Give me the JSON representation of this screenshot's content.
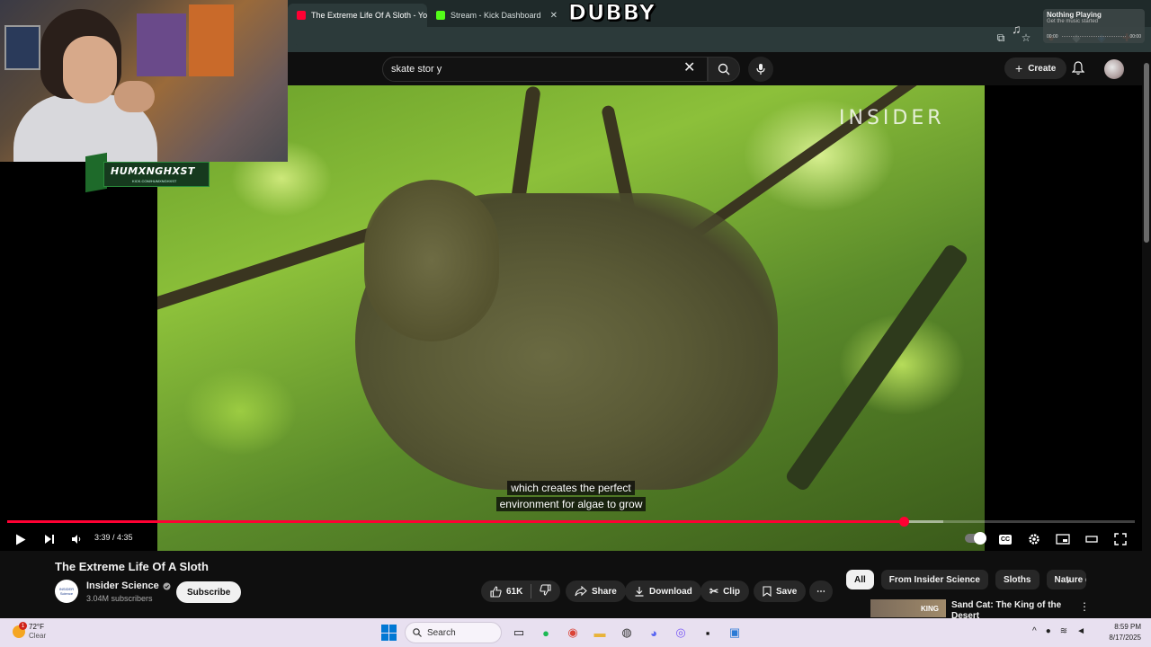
{
  "browser": {
    "tabs": [
      {
        "label": "The Extreme Life Of A Sloth - YouTube",
        "favicon_color": "#ff0033",
        "active": true
      },
      {
        "label": "Stream - Kick Dashboard",
        "favicon_color": "#53fc18",
        "active": false
      }
    ],
    "overlay_title": "DUBBY"
  },
  "now_playing": {
    "title": "Nothing Playing",
    "subtitle": "Get the music started",
    "time_start": "00:00",
    "time_end": "00:00"
  },
  "streamer": {
    "name": "HUMXNGHXST",
    "url": "KICK.COM/HUMXNGHXST"
  },
  "youtube": {
    "search": {
      "value": "skate stor y"
    },
    "create_label": "Create",
    "video": {
      "watermark": "INSIDER",
      "caption_line1": "which creates the perfect",
      "caption_line2": "environment for algae to grow",
      "time_display": "3:39 / 4:35",
      "progress": 0.795,
      "buffered": 0.83,
      "cc_label": "CC"
    },
    "title": "The Extreme Life Of A Sloth",
    "channel": {
      "name": "Insider Science",
      "subscribers": "3.04M subscribers",
      "avatar_text": "INSIDER Science",
      "subscribe_label": "Subscribe"
    },
    "actions": {
      "likes": "61K",
      "share": "Share",
      "download": "Download",
      "clip": "Clip",
      "save": "Save"
    },
    "chips": [
      "All",
      "From Insider Science",
      "Sloths",
      "Nature d"
    ],
    "recommendation": {
      "thumb_text": "KING",
      "title": "Sand Cat: The King of the Desert"
    }
  },
  "taskbar": {
    "weather_temp": "72°F",
    "weather_desc": "Clear",
    "weather_alert": "1",
    "search_label": "Search",
    "time": "8:59 PM",
    "date": "8/17/2025"
  },
  "colors": {
    "accent": "#ff0033",
    "bg": "#0f0f0f",
    "chip_bg": "#272727"
  }
}
